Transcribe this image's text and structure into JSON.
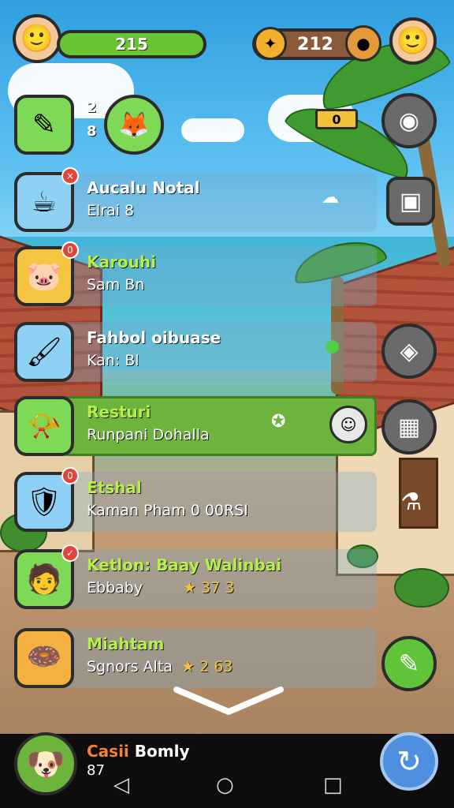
{
  "hud": {
    "xp_value": "215",
    "coin_value": "212",
    "timer_label": "0"
  },
  "quests": [
    {
      "title": "Aucalu Notal",
      "subtitle": "Elrai 8",
      "badge": "×"
    },
    {
      "title": "Karouhi",
      "subtitle": "Sam Bn",
      "badge": "0"
    },
    {
      "title": "Fahbol oibuase",
      "subtitle": "Kan: Bl",
      "badge": ""
    },
    {
      "title": "Resturi",
      "subtitle": "Runpani Dohalla",
      "badge": ""
    },
    {
      "title": "Etshal",
      "subtitle": "Kaman Pham 0 00RSI",
      "badge": "0"
    },
    {
      "title": "Ketlon: Baay Walinbai",
      "subtitle": "Ebbaby",
      "badge": "✓",
      "stat": "★ 37 3"
    },
    {
      "title": "Miahtam",
      "subtitle": "Sgnors Alta",
      "badge": "",
      "stat": "★ 2 63"
    }
  ],
  "top_quest": {
    "top_num": "2",
    "bottom_num": "8"
  },
  "player": {
    "first_name": "Casii",
    "last_name": "Bomly",
    "level": "87"
  },
  "icons": {
    "profile": "boy-face-icon",
    "coin": "coin-icon",
    "settings": "gamepad-icon",
    "map": "cloud-map-icon",
    "device": "device-icon",
    "add": "pencil-icon",
    "refresh": "refresh-icon"
  },
  "colors": {
    "xp_green": "#67c531",
    "highlight_green": "#6cb43c",
    "badge_red": "#e0443a",
    "title_green": "#b6ef4a"
  }
}
